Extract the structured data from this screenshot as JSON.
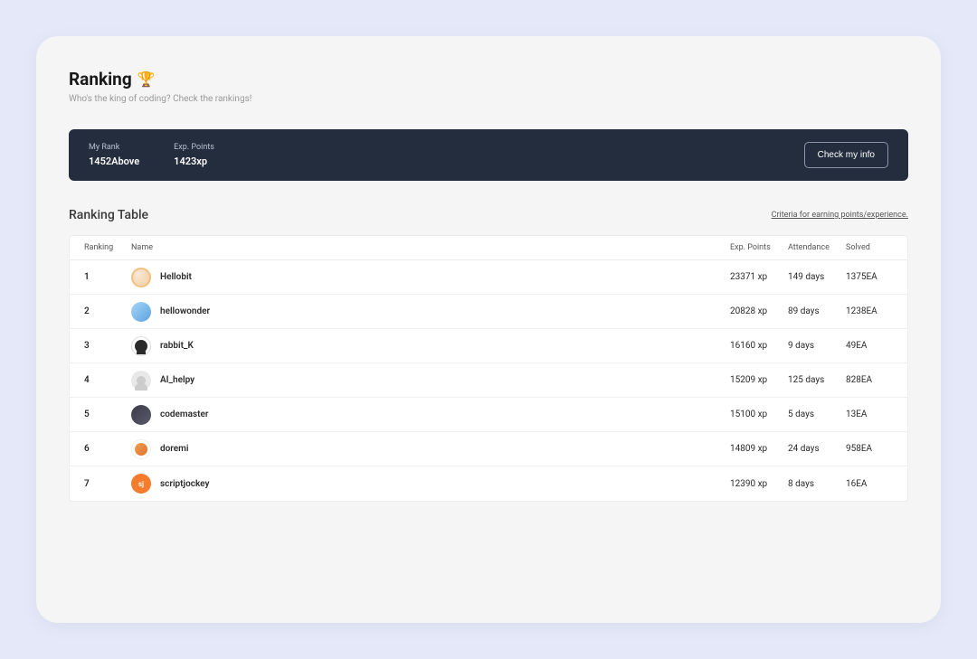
{
  "header": {
    "title": "Ranking",
    "trophy_emoji": "🏆",
    "subtitle": "Who's the king of coding? Check the rankings!"
  },
  "rank_bar": {
    "my_rank_label": "My Rank",
    "my_rank_value": "1452Above",
    "exp_label": "Exp. Points",
    "exp_value": "1423xp",
    "button_label": "Check my info"
  },
  "table": {
    "title": "Ranking Table",
    "criteria_link": "Criteria for earning points/experience.",
    "columns": {
      "rank": "Ranking",
      "name": "Name",
      "exp": "Exp. Points",
      "attendance": "Attendance",
      "solved": "Solved"
    },
    "rows": [
      {
        "rank": "1",
        "name": "Hellobit",
        "exp": "23371 xp",
        "attendance": "149 days",
        "solved": "1375EA",
        "avatar_text": ""
      },
      {
        "rank": "2",
        "name": "hellowonder",
        "exp": "20828 xp",
        "attendance": "89 days",
        "solved": "1238EA",
        "avatar_text": ""
      },
      {
        "rank": "3",
        "name": "rabbit_K",
        "exp": "16160 xp",
        "attendance": "9 days",
        "solved": "49EA",
        "avatar_text": ""
      },
      {
        "rank": "4",
        "name": "AI_helpy",
        "exp": "15209 xp",
        "attendance": "125 days",
        "solved": "828EA",
        "avatar_text": ""
      },
      {
        "rank": "5",
        "name": "codemaster",
        "exp": "15100 xp",
        "attendance": "5 days",
        "solved": "13EA",
        "avatar_text": ""
      },
      {
        "rank": "6",
        "name": "doremi",
        "exp": "14809 xp",
        "attendance": "24 days",
        "solved": "958EA",
        "avatar_text": ""
      },
      {
        "rank": "7",
        "name": "scriptjockey",
        "exp": "12390 xp",
        "attendance": "8 days",
        "solved": "16EA",
        "avatar_text": "sj"
      }
    ]
  }
}
